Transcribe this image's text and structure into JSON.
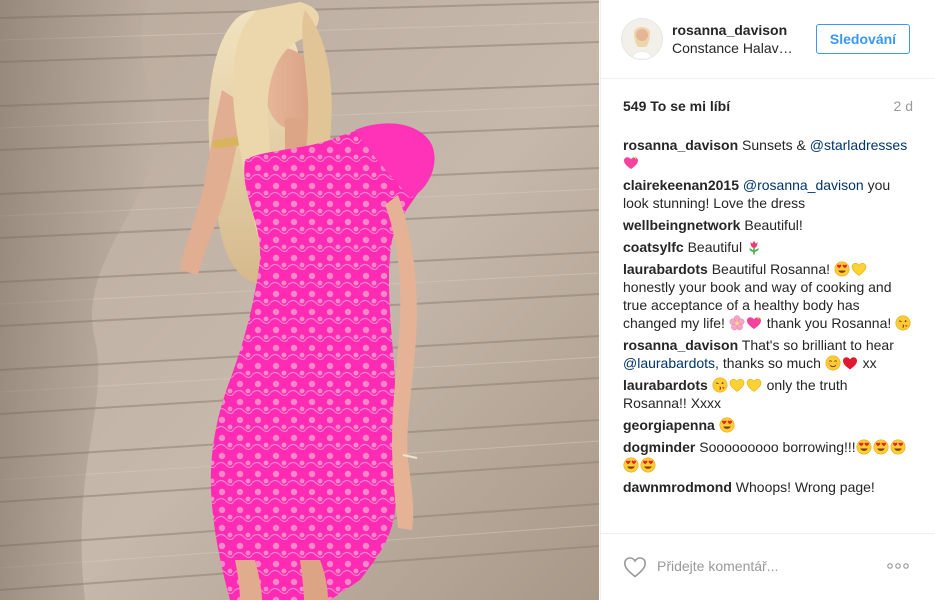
{
  "post": {
    "username": "rosanna_davison",
    "location": "Constance Halaveli Maldives",
    "follow_label": "Sledování",
    "likes": "549 To se mi líbí",
    "time": "2 d"
  },
  "comments": [
    {
      "user": "rosanna_davison",
      "parts": [
        {
          "t": "text",
          "v": " Sunsets & "
        },
        {
          "t": "mention",
          "v": "@starladresses"
        },
        {
          "t": "text",
          "v": " "
        },
        {
          "t": "emoji",
          "v": "sparkling-heart"
        }
      ]
    },
    {
      "user": "clairekeenan2015",
      "parts": [
        {
          "t": "text",
          "v": " "
        },
        {
          "t": "mention",
          "v": "@rosanna_davison"
        },
        {
          "t": "text",
          "v": " you look stunning! Love the dress"
        }
      ]
    },
    {
      "user": "wellbeingnetwork",
      "parts": [
        {
          "t": "text",
          "v": " Beautiful!"
        }
      ]
    },
    {
      "user": "coatsylfc",
      "parts": [
        {
          "t": "text",
          "v": " Beautiful "
        },
        {
          "t": "emoji",
          "v": "tulip"
        }
      ]
    },
    {
      "user": "laurabardots",
      "parts": [
        {
          "t": "text",
          "v": " Beautiful Rosanna! "
        },
        {
          "t": "emoji",
          "v": "heart-eyes"
        },
        {
          "t": "emoji",
          "v": "yellow-heart"
        },
        {
          "t": "text",
          "v": " honestly your book and way of cooking and true acceptance of a healthy body has changed my life! "
        },
        {
          "t": "emoji",
          "v": "cherry-blossom"
        },
        {
          "t": "emoji",
          "v": "sparkling-heart"
        },
        {
          "t": "text",
          "v": " thank you Rosanna! "
        },
        {
          "t": "emoji",
          "v": "kiss-face"
        }
      ]
    },
    {
      "user": "rosanna_davison",
      "parts": [
        {
          "t": "text",
          "v": " That's so brilliant to hear "
        },
        {
          "t": "mention",
          "v": "@laurabardots"
        },
        {
          "t": "text",
          "v": ", thanks so much "
        },
        {
          "t": "emoji",
          "v": "smiling-face"
        },
        {
          "t": "emoji",
          "v": "red-heart"
        },
        {
          "t": "text",
          "v": " xx"
        }
      ]
    },
    {
      "user": "laurabardots",
      "parts": [
        {
          "t": "text",
          "v": " "
        },
        {
          "t": "emoji",
          "v": "kiss-face"
        },
        {
          "t": "emoji",
          "v": "yellow-heart"
        },
        {
          "t": "emoji",
          "v": "yellow-heart"
        },
        {
          "t": "text",
          "v": " only the truth Rosanna!! Xxxx"
        }
      ]
    },
    {
      "user": "georgiapenna",
      "parts": [
        {
          "t": "text",
          "v": " "
        },
        {
          "t": "emoji",
          "v": "heart-eyes"
        }
      ]
    },
    {
      "user": "dogminder",
      "parts": [
        {
          "t": "text",
          "v": " Sooooooooo borrowing!!!"
        },
        {
          "t": "emoji",
          "v": "heart-eyes"
        },
        {
          "t": "emoji",
          "v": "heart-eyes"
        },
        {
          "t": "emoji",
          "v": "heart-eyes"
        },
        {
          "t": "emoji",
          "v": "heart-eyes"
        },
        {
          "t": "emoji",
          "v": "heart-eyes"
        }
      ]
    },
    {
      "user": "dawnmrodmond",
      "parts": [
        {
          "t": "text",
          "v": " Whoops! Wrong page!"
        }
      ]
    }
  ],
  "footer": {
    "comment_placeholder": "Přidejte komentář...",
    "like_icon": "heart-outline-icon",
    "more_icon": "more-options-icon"
  },
  "colors": {
    "accent": "#3897f0",
    "mention": "#003569",
    "text": "#262626",
    "muted": "#999999",
    "divider": "#efefef",
    "dress": "#ff2bb4"
  }
}
